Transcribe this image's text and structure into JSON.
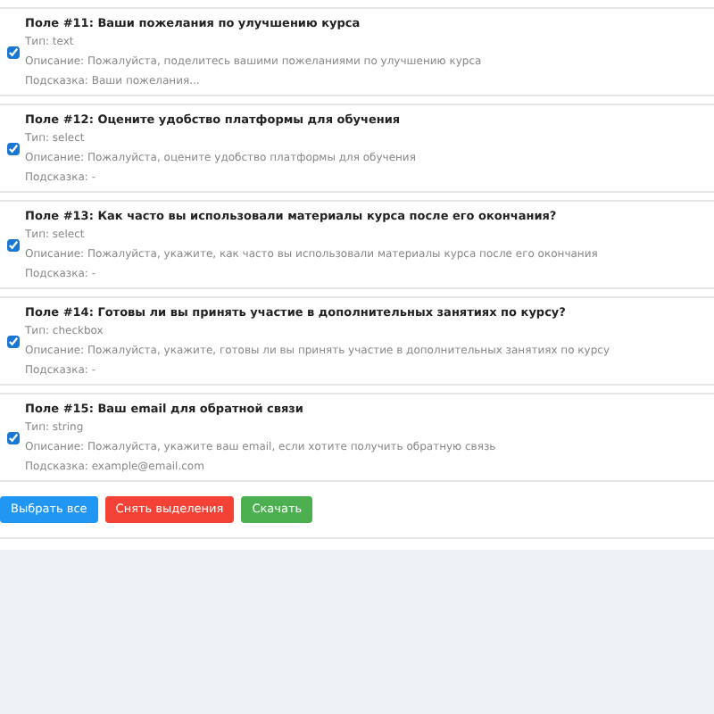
{
  "fields": [
    {
      "title": "Поле #11: Ваши пожелания по улучшению курса",
      "type": "Тип: text",
      "description": "Описание: Пожалуйста, поделитесь вашими пожеланиями по улучшению курса",
      "hint": "Подсказка: Ваши пожелания...",
      "checked": true
    },
    {
      "title": "Поле #12: Оцените удобство платформы для обучения",
      "type": "Тип: select",
      "description": "Описание: Пожалуйста, оцените удобство платформы для обучения",
      "hint": "Подсказка: -",
      "checked": true
    },
    {
      "title": "Поле #13: Как часто вы использовали материалы курса после его окончания?",
      "type": "Тип: select",
      "description": "Описание: Пожалуйста, укажите, как часто вы использовали материалы курса после его окончания",
      "hint": "Подсказка: -",
      "checked": true
    },
    {
      "title": "Поле #14: Готовы ли вы принять участие в дополнительных занятиях по курсу?",
      "type": "Тип: checkbox",
      "description": "Описание: Пожалуйста, укажите, готовы ли вы принять участие в дополнительных занятиях по курсу",
      "hint": "Подсказка: -",
      "checked": true
    },
    {
      "title": "Поле #15: Ваш email для обратной связи",
      "type": "Тип: string",
      "description": "Описание: Пожалуйста, укажите ваш email, если хотите получить обратную связь",
      "hint": "Подсказка: example@email.com",
      "checked": true
    }
  ],
  "buttons": [
    {
      "label": "Выбрать все",
      "kind": "primary"
    },
    {
      "label": "Снять выделения",
      "kind": "danger"
    },
    {
      "label": "Скачать",
      "kind": "success"
    }
  ]
}
